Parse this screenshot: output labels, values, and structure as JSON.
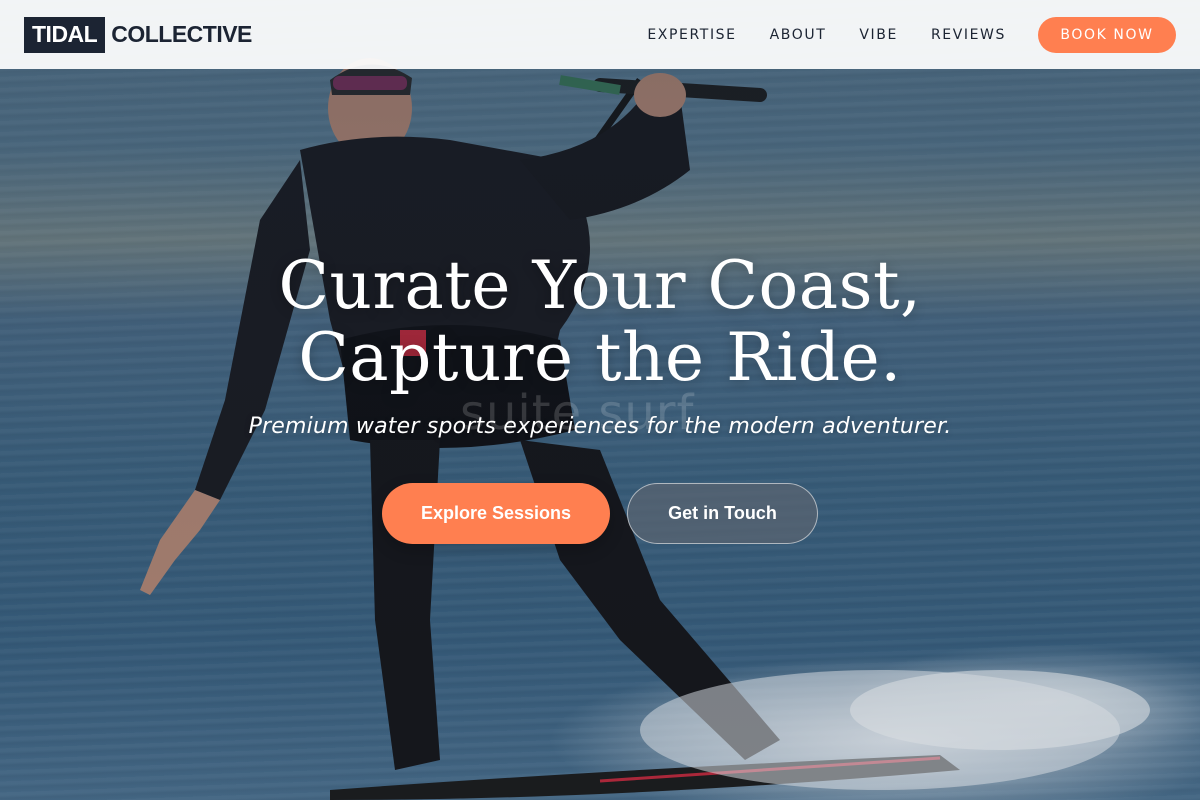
{
  "brand": {
    "logo_box_text": "TIDAL",
    "logo_text": "COLLECTIVE",
    "accent_color": "#ff7f50",
    "dark_color": "#1c2433"
  },
  "nav": {
    "links": [
      "EXPERTISE",
      "ABOUT",
      "VIBE",
      "REVIEWS"
    ],
    "cta_label": "BOOK NOW"
  },
  "hero": {
    "title_line1": "Curate Your Coast,",
    "title_line2": "Capture the Ride.",
    "subtitle": "Premium water sports experiences for the modern adventurer.",
    "ghost_text": "suite surf",
    "primary_cta": "Explore Sessions",
    "secondary_cta": "Get in Touch"
  }
}
